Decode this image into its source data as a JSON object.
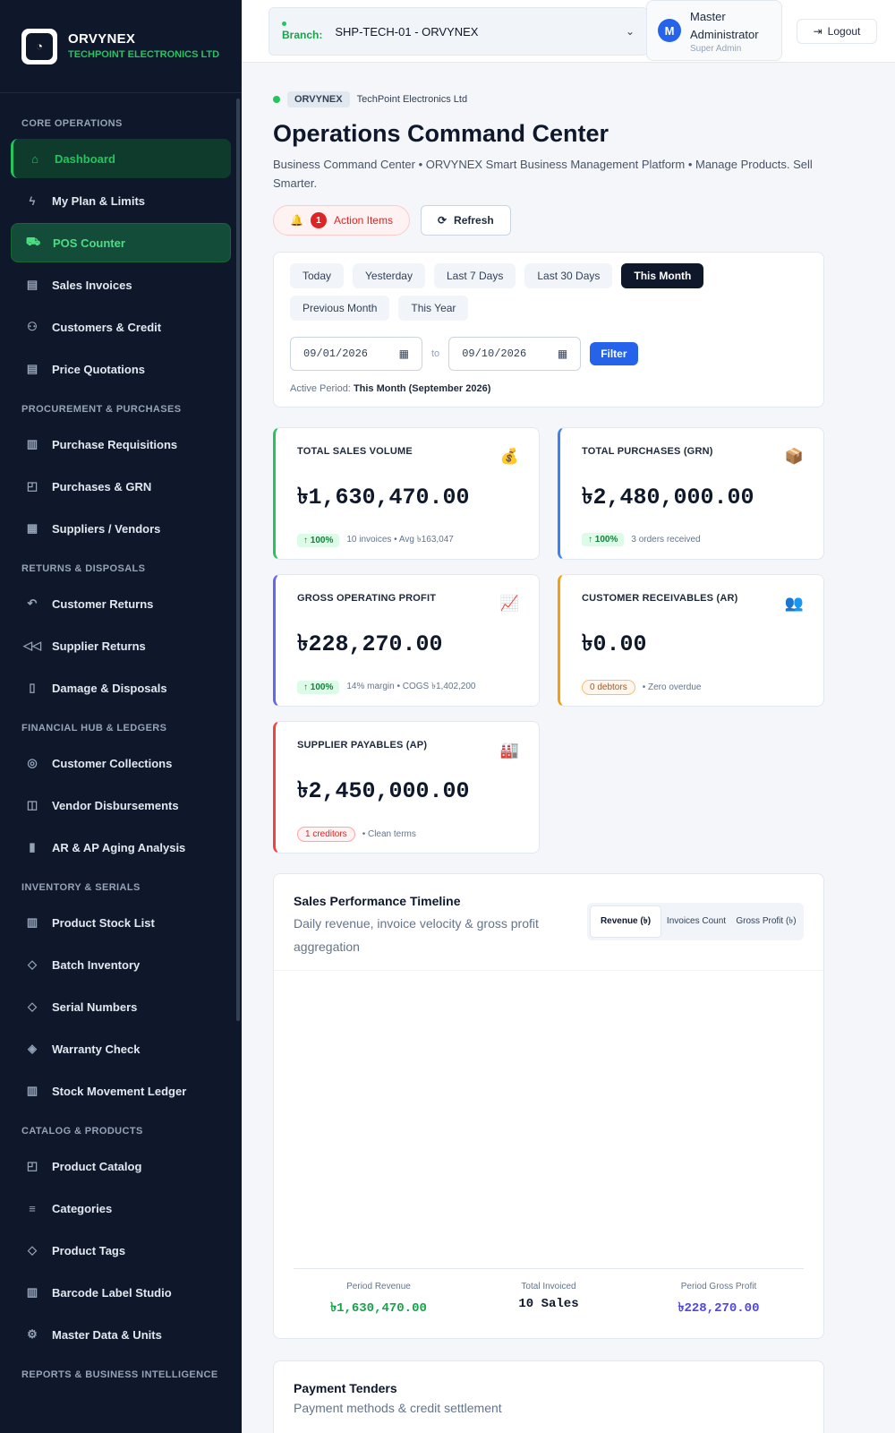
{
  "brand": {
    "name": "ORVYNEX",
    "subtitle": "TECHPOINT ELECTRONICS LTD"
  },
  "sidebar": {
    "sections": [
      {
        "title": "CORE OPERATIONS",
        "items": [
          {
            "label": "Dashboard",
            "icon": "home-icon",
            "state": "active"
          },
          {
            "label": "My Plan & Limits",
            "icon": "bolt-icon",
            "state": ""
          },
          {
            "label": "POS Counter",
            "icon": "cart-icon",
            "state": "pos"
          },
          {
            "label": "Sales Invoices",
            "icon": "document-icon",
            "state": ""
          },
          {
            "label": "Customers & Credit",
            "icon": "users-icon",
            "state": ""
          },
          {
            "label": "Price Quotations",
            "icon": "document-icon",
            "state": ""
          }
        ]
      },
      {
        "title": "PROCUREMENT & PURCHASES",
        "items": [
          {
            "label": "Purchase Requisitions",
            "icon": "clipboard-icon",
            "state": ""
          },
          {
            "label": "Purchases & GRN",
            "icon": "bag-icon",
            "state": ""
          },
          {
            "label": "Suppliers / Vendors",
            "icon": "building-icon",
            "state": ""
          }
        ]
      },
      {
        "title": "RETURNS & DISPOSALS",
        "items": [
          {
            "label": "Customer Returns",
            "icon": "return-icon",
            "state": ""
          },
          {
            "label": "Supplier Returns",
            "icon": "rewind-icon",
            "state": ""
          },
          {
            "label": "Damage & Disposals",
            "icon": "trash-icon",
            "state": ""
          }
        ]
      },
      {
        "title": "FINANCIAL HUB & LEDGERS",
        "items": [
          {
            "label": "Customer Collections",
            "icon": "coin-icon",
            "state": ""
          },
          {
            "label": "Vendor Disbursements",
            "icon": "wallet-icon",
            "state": ""
          },
          {
            "label": "AR & AP Aging Analysis",
            "icon": "bar-chart-icon",
            "state": ""
          }
        ]
      },
      {
        "title": "INVENTORY & SERIALS",
        "items": [
          {
            "label": "Product Stock List",
            "icon": "clipboard-icon",
            "state": ""
          },
          {
            "label": "Batch Inventory",
            "icon": "cube-icon",
            "state": ""
          },
          {
            "label": "Serial Numbers",
            "icon": "tag-icon",
            "state": ""
          },
          {
            "label": "Warranty Check",
            "icon": "shield-icon",
            "state": ""
          },
          {
            "label": "Stock Movement Ledger",
            "icon": "clipboard-icon",
            "state": ""
          }
        ]
      },
      {
        "title": "CATALOG & PRODUCTS",
        "items": [
          {
            "label": "Product Catalog",
            "icon": "bag-icon",
            "state": ""
          },
          {
            "label": "Categories",
            "icon": "list-icon",
            "state": ""
          },
          {
            "label": "Product Tags",
            "icon": "tag-icon",
            "state": ""
          },
          {
            "label": "Barcode Label Studio",
            "icon": "barcode-icon",
            "state": ""
          },
          {
            "label": "Master Data & Units",
            "icon": "gear-icon",
            "state": ""
          }
        ]
      },
      {
        "title": "REPORTS & BUSINESS INTELLIGENCE",
        "items": []
      }
    ]
  },
  "topbar": {
    "branch_label": "Branch:",
    "branch_value": "SHP-TECH-01 - ORVYNEX",
    "user_initial": "M",
    "user_name": "Master Administrator",
    "user_role": "Super Admin",
    "logout_label": "Logout"
  },
  "header": {
    "tag": "ORVYNEX",
    "company": "TechPoint Electronics Ltd",
    "title": "Operations Command Center",
    "subtitle": "Business Command Center • ORVYNEX Smart Business Management Platform • Manage Products. Sell Smarter.",
    "action_items_count": "1",
    "action_items_label": "Action Items",
    "refresh_label": "Refresh"
  },
  "filters": {
    "chips": [
      {
        "label": "Today",
        "active": false
      },
      {
        "label": "Yesterday",
        "active": false
      },
      {
        "label": "Last 7 Days",
        "active": false
      },
      {
        "label": "Last 30 Days",
        "active": false
      },
      {
        "label": "This Month",
        "active": true
      },
      {
        "label": "Previous Month",
        "active": false
      },
      {
        "label": "This Year",
        "active": false
      }
    ],
    "date_from": "09/01/2026",
    "date_to": "09/10/2026",
    "to_label": "to",
    "filter_label": "Filter",
    "active_period_label": "Active Period:",
    "active_period_value": "This Month (September 2026)"
  },
  "kpis": [
    {
      "label": "TOTAL SALES VOLUME",
      "icon": "💰",
      "value": "৳1,630,470.00",
      "pill": "↑ 100%",
      "pill_style": "g",
      "note": "10 invoices • Avg ৳163,047",
      "accent": "#22c55e"
    },
    {
      "label": "TOTAL PURCHASES (GRN)",
      "icon": "📦",
      "value": "৳2,480,000.00",
      "pill": "↑ 100%",
      "pill_style": "g",
      "note": "3 orders received",
      "accent": "#3b82f6"
    },
    {
      "label": "GROSS OPERATING PROFIT",
      "icon": "📈",
      "value": "৳228,270.00",
      "pill": "↑ 100%",
      "pill_style": "g",
      "note": "14% margin • COGS ৳1,402,200",
      "accent": "#6366f1"
    },
    {
      "label": "CUSTOMER RECEIVABLES (AR)",
      "icon": "👥",
      "value": "৳0.00",
      "pill": "0 debtors",
      "pill_style": "o",
      "note": "• Zero overdue",
      "accent": "#f59e0b"
    },
    {
      "label": "SUPPLIER PAYABLES (AP)",
      "icon": "🏭",
      "value": "৳2,450,000.00",
      "pill": "1 creditors",
      "pill_style": "r",
      "note": "• Clean terms",
      "accent": "#ef4444"
    }
  ],
  "chart": {
    "title": "Sales Performance Timeline",
    "subtitle": "Daily revenue, invoice velocity & gross profit aggregation",
    "tabs": [
      {
        "label": "Revenue (৳)",
        "active": true
      },
      {
        "label": "Invoices Count",
        "active": false
      },
      {
        "label": "Gross Profit (৳)",
        "active": false
      }
    ],
    "summary": [
      {
        "label": "Period Revenue",
        "value": "৳1,630,470.00",
        "color": "#16a34a"
      },
      {
        "label": "Total Invoiced",
        "value": "10 Sales",
        "color": "#0f172a"
      },
      {
        "label": "Period Gross Profit",
        "value": "৳228,270.00",
        "color": "#4f46e5"
      }
    ]
  },
  "payments": {
    "title": "Payment Tenders",
    "subtitle": "Payment methods & credit settlement"
  }
}
